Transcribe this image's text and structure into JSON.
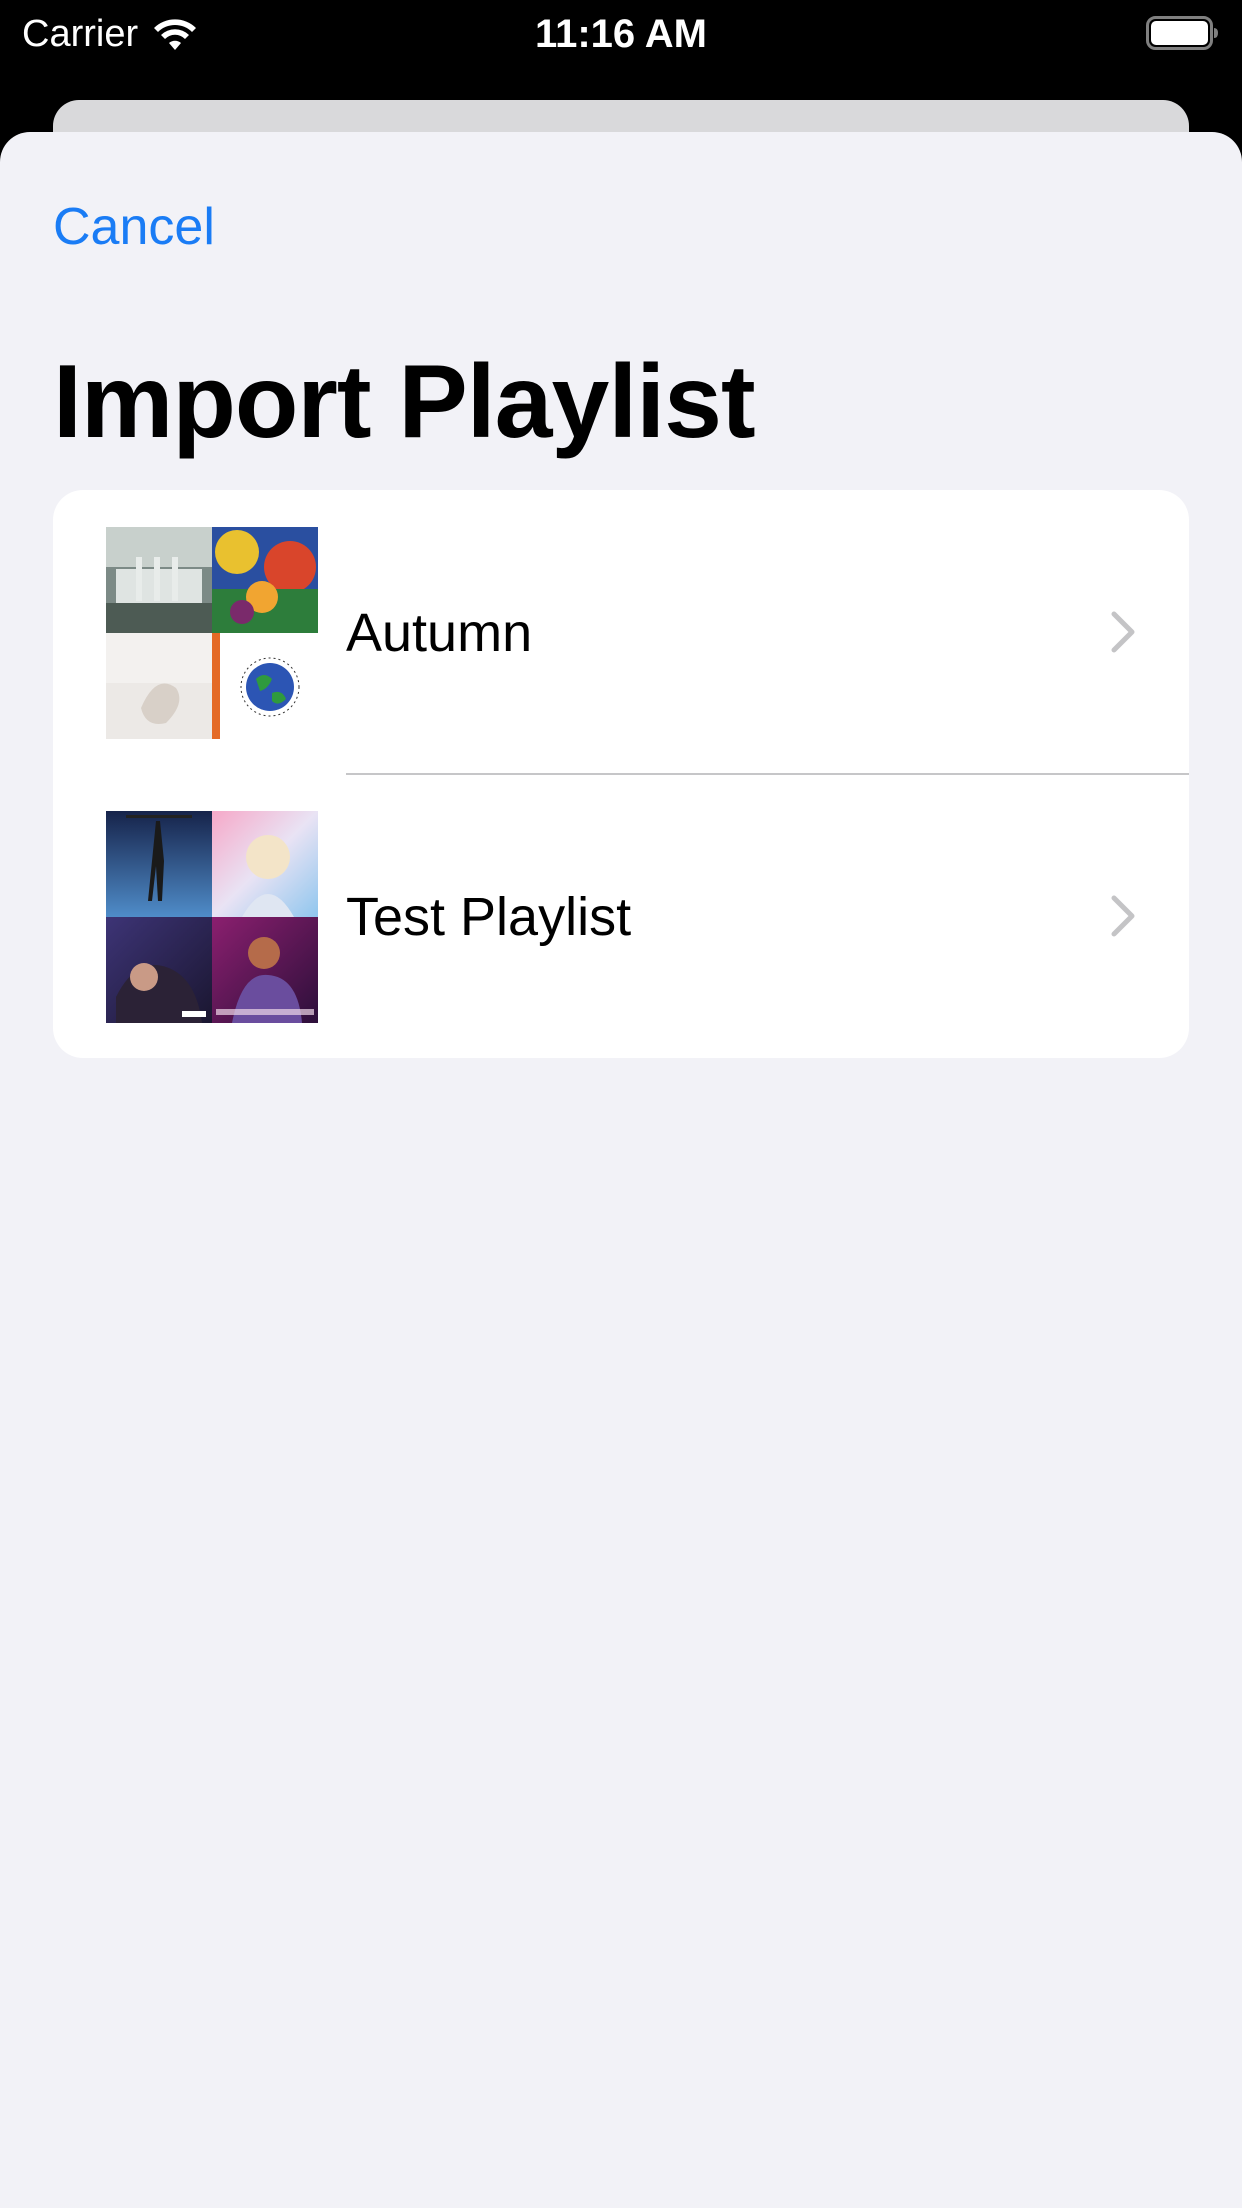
{
  "status_bar": {
    "carrier": "Carrier",
    "time": "11:16 AM",
    "wifi_icon": "wifi-icon",
    "battery_icon": "battery-icon"
  },
  "sheet": {
    "cancel_label": "Cancel",
    "title": "Import Playlist"
  },
  "playlists": [
    {
      "name": "Autumn",
      "artwork_icon": "playlist-artwork",
      "chevron_icon": "chevron-right-icon"
    },
    {
      "name": "Test Playlist",
      "artwork_icon": "playlist-artwork",
      "chevron_icon": "chevron-right-icon"
    }
  ],
  "colors": {
    "accent": "#1a7cf5",
    "background": "#f2f2f7",
    "card": "#ffffff",
    "separator": "#c6c6c8",
    "chevron": "#c4c4c6"
  }
}
